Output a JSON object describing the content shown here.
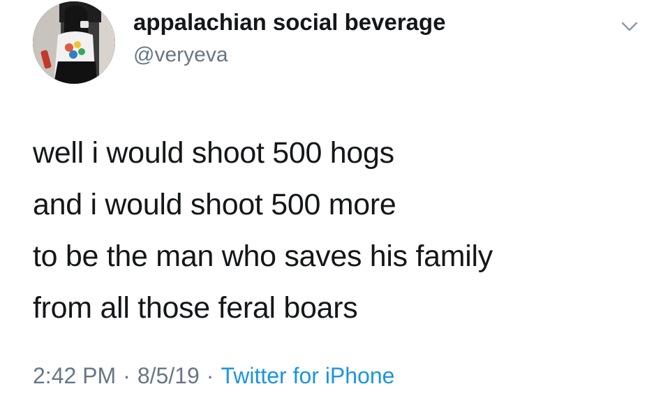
{
  "header": {
    "display_name": "appalachian social beverage",
    "handle": "@veryeva",
    "avatar_icon": "profile-photo",
    "more_icon": "chevron-down-icon"
  },
  "tweet": {
    "lines": [
      "well i would shoot 500 hogs",
      "and i would shoot 500 more",
      "to be the man who saves his family",
      "from all those feral boars"
    ]
  },
  "meta": {
    "time": "2:42 PM",
    "separator": "·",
    "date": "8/5/19",
    "source": "Twitter for iPhone"
  },
  "colors": {
    "text": "#14171a",
    "secondary": "#657786",
    "link": "#1b95e0",
    "background": "#ffffff"
  }
}
